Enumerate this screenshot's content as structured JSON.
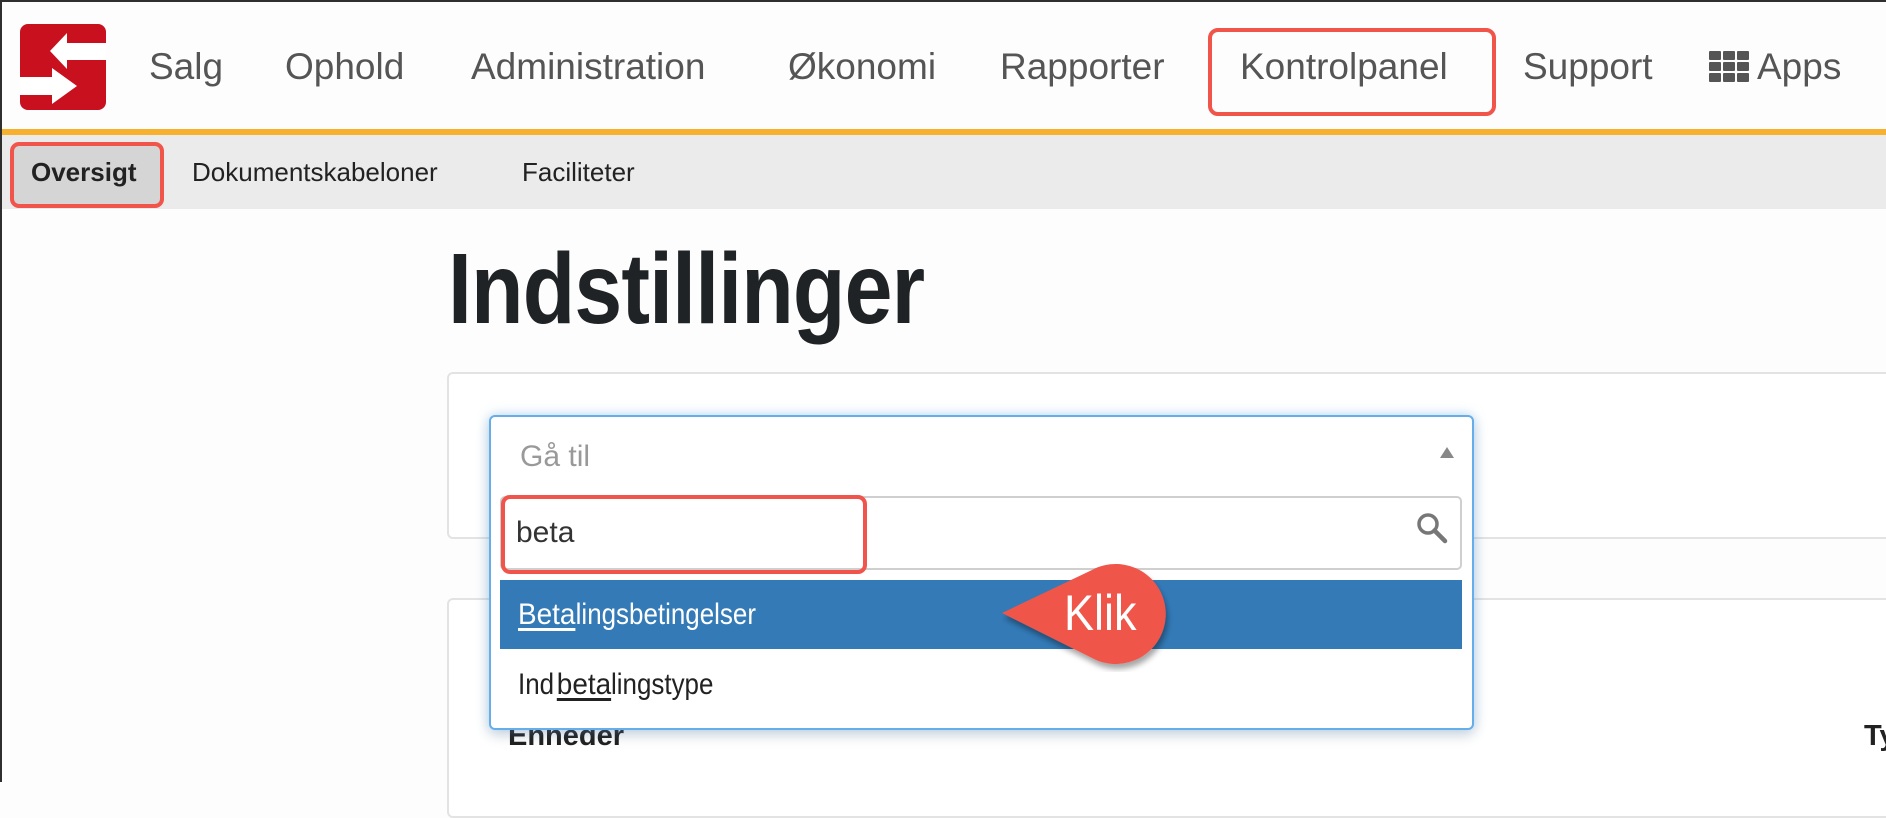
{
  "header": {
    "logo_alt": "logo",
    "nav": [
      {
        "label": "Salg"
      },
      {
        "label": "Ophold"
      },
      {
        "label": "Administration"
      },
      {
        "label": "Økonomi"
      },
      {
        "label": "Rapporter"
      },
      {
        "label": "Kontrolpanel",
        "highlighted": true
      },
      {
        "label": "Support"
      },
      {
        "label": "Apps",
        "icon": "grid-icon"
      }
    ]
  },
  "subnav": {
    "items": [
      {
        "label": "Oversigt",
        "active": true
      },
      {
        "label": "Dokumentskabeloner"
      },
      {
        "label": "Faciliteter"
      }
    ]
  },
  "page": {
    "title": "Indstillinger"
  },
  "goto_select": {
    "placeholder": "Gå til",
    "search_value": "beta",
    "options": [
      {
        "label_match": "Beta",
        "label_rest": "lingsbetingelser",
        "prefix": "",
        "highlighted": true
      },
      {
        "prefix": "Ind",
        "label_match": "beta",
        "label_rest": "lingstype",
        "highlighted": false
      }
    ]
  },
  "annotation": {
    "callout": "Klik"
  },
  "panel2": {
    "col1_header": "Enheder",
    "col2_header_partial": "Ty"
  },
  "colors": {
    "brand_red": "#c8101e",
    "accent_orange": "#f7b12f",
    "highlight_blue": "#337ab7",
    "annotation_red": "#f0544a"
  }
}
